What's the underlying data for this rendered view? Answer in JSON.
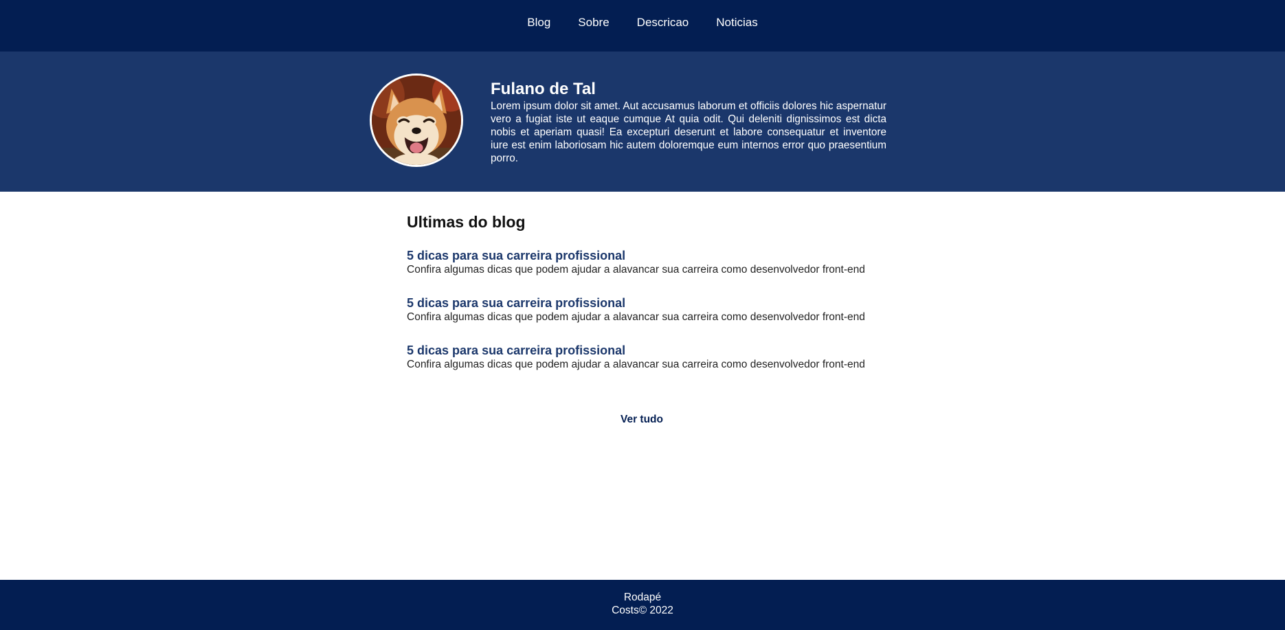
{
  "nav": {
    "items": [
      {
        "label": "Blog"
      },
      {
        "label": "Sobre"
      },
      {
        "label": "Descricao"
      },
      {
        "label": "Noticias"
      }
    ]
  },
  "profile": {
    "name": "Fulano de Tal",
    "bio": "Lorem ipsum dolor sit amet. Aut accusamus laborum et officiis dolores hic aspernatur vero a fugiat iste ut eaque cumque At quia odit. Qui deleniti dignissimos est dicta nobis et aperiam quasi! Ea excepturi deserunt et labore consequatur et inventore iure est enim laboriosam hic autem doloremque eum internos error quo praesentium porro.",
    "avatar_icon": "shiba-dog-photo"
  },
  "blog": {
    "heading": "Ultimas do blog",
    "posts": [
      {
        "title": "5 dicas para sua carreira profissional",
        "description": "Confira algumas dicas que podem ajudar a alavancar sua carreira como desenvolvedor front-end"
      },
      {
        "title": "5 dicas para sua carreira profissional",
        "description": "Confira algumas dicas que podem ajudar a alavancar sua carreira como desenvolvedor front-end"
      },
      {
        "title": "5 dicas para sua carreira profissional",
        "description": "Confira algumas dicas que podem ajudar a alavancar sua carreira como desenvolvedor front-end"
      }
    ],
    "see_all_label": "Ver tudo"
  },
  "footer": {
    "line1": "Rodapé",
    "line2": "Costs© 2022"
  },
  "colors": {
    "nav_bg": "#031e52",
    "profile_bg": "#1b376b",
    "accent": "#1b376b"
  }
}
